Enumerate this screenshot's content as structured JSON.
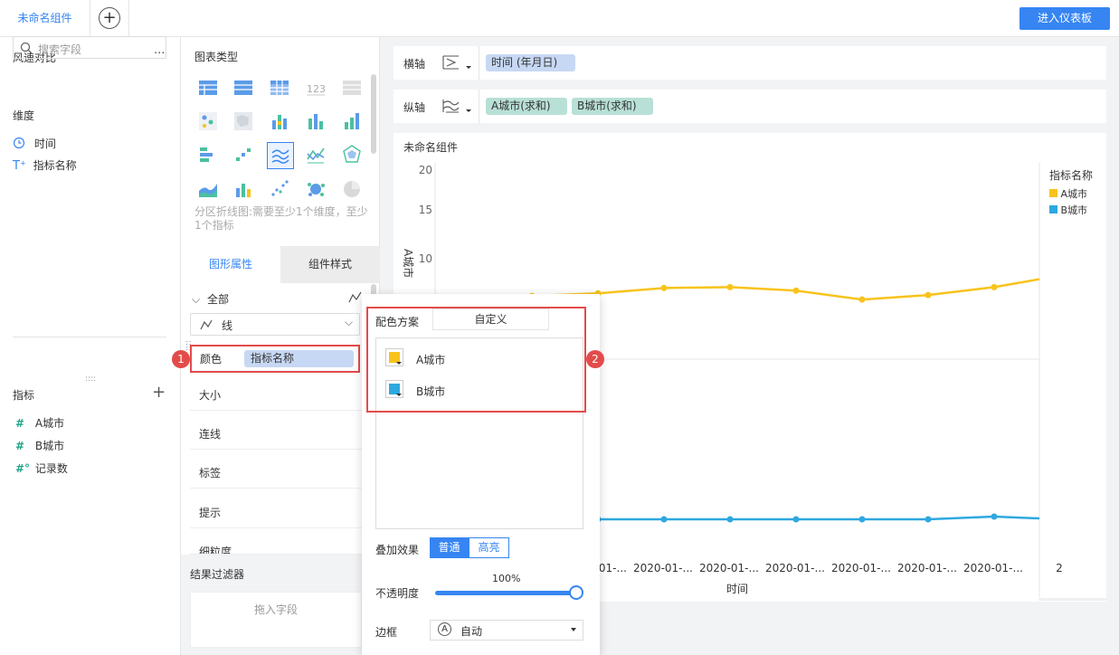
{
  "topbar": {
    "tab_label": "未命名组件",
    "add_tab": "+",
    "enter_label": "进入仪表板"
  },
  "left": {
    "dataset": "风速对比",
    "more": "···",
    "search_placeholder": "搜索字段",
    "dim_title": "维度",
    "dimensions": [
      {
        "icon": "clock-icon",
        "label": "时间"
      },
      {
        "icon": "text-type-icon",
        "label": "指标名称"
      }
    ],
    "mea_title": "指标",
    "add": "+",
    "measures": [
      {
        "icon": "#",
        "label": "A城市"
      },
      {
        "icon": "#",
        "label": "B城市"
      },
      {
        "icon": "#°",
        "label": "记录数"
      }
    ]
  },
  "mid": {
    "chart_type_title": "图表类型",
    "chart_hint": "分区折线图:需要至少1个维度，至少1个指标",
    "tabs": {
      "graph": "图形属性",
      "style": "组件样式"
    },
    "all_label": "全部",
    "mark_type": "线",
    "color_label": "颜色",
    "color_field": "指标名称",
    "rows": [
      "大小",
      "连线",
      "标签",
      "提示",
      "细粒度"
    ],
    "filter_title": "结果过滤器",
    "filter_drop": "拖入字段"
  },
  "badges": [
    "1",
    "2"
  ],
  "axes": {
    "x_label": "横轴",
    "x_field": "时间 (年月日)",
    "y_label": "纵轴",
    "y_fields": [
      "A城市(求和)",
      "B城市(求和)"
    ]
  },
  "chart_title": "未命名组件",
  "legend": {
    "title": "指标名称",
    "items": [
      {
        "label": "A城市",
        "color": "#f8c31b"
      },
      {
        "label": "B城市",
        "color": "#2ea8e0"
      }
    ]
  },
  "popup": {
    "scheme_label": "配色方案",
    "scheme_value": "自定义",
    "items": [
      {
        "label": "A城市",
        "color": "#f8c31b"
      },
      {
        "label": "B城市",
        "color": "#2ea8e0"
      }
    ],
    "overlay_label": "叠加效果",
    "overlay_options": [
      "普通",
      "高亮"
    ],
    "opacity_label": "不透明度",
    "opacity_value": "100%",
    "border_label": "边框",
    "border_value": "自动",
    "border_icon": "A"
  },
  "chart_data": {
    "type": "line",
    "ylabel": "A城市",
    "xlabel": "时间",
    "yticks": [
      "20",
      "15",
      "10"
    ],
    "x_tick_labels": [
      "2020-01-...",
      "2020-01-...",
      "2020-01-...",
      "2020-01-...",
      "2020-01-...",
      "2020-01-...",
      "2020-01-...",
      "2020-01-...",
      "2"
    ],
    "series": [
      {
        "name": "A城市",
        "color": "#f8c31b",
        "values": [
          4.9,
          5.7,
          6.0,
          6.6,
          6.7,
          6.3,
          5.3,
          5.8,
          6.7,
          8.0
        ]
      },
      {
        "name": "B城市",
        "color": "#2ea8e0",
        "values": [
          2.0,
          2.0,
          2.0,
          2.0,
          2.0,
          2.0,
          2.0,
          2.0,
          2.1,
          2.0
        ]
      }
    ]
  }
}
